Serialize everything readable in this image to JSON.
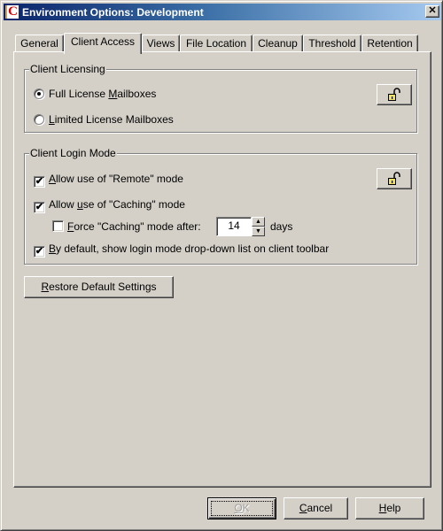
{
  "window": {
    "title": "Environment Options:  Development",
    "app_icon": "c-logo-icon",
    "close_glyph": "✕"
  },
  "tabs": [
    {
      "label": "General",
      "active": false
    },
    {
      "label": "Client Access",
      "active": true
    },
    {
      "label": "Views",
      "active": false
    },
    {
      "label": "File Location",
      "active": false
    },
    {
      "label": "Cleanup",
      "active": false
    },
    {
      "label": "Threshold",
      "active": false
    },
    {
      "label": "Retention",
      "active": false
    }
  ],
  "client_licensing": {
    "label": "Client Licensing",
    "options": [
      {
        "label_pre": "Full License ",
        "mnemonic": "M",
        "label_post": "ailboxes",
        "selected": true
      },
      {
        "label_pre": "",
        "mnemonic": "L",
        "label_post": "imited License Mailboxes",
        "selected": false
      }
    ],
    "lock_icon": "unlocked-padlock-icon"
  },
  "client_login_mode": {
    "label": "Client Login Mode",
    "allow_remote": {
      "label_pre": "",
      "mnemonic": "A",
      "label_post": "llow use of \"Remote\" mode",
      "checked": true
    },
    "allow_caching": {
      "label_pre": "Allow ",
      "mnemonic": "u",
      "label_post": "se of \"Caching\" mode",
      "checked": true
    },
    "force_caching": {
      "label_pre": "",
      "mnemonic": "F",
      "label_post": "orce  \"Caching\" mode after:",
      "checked": false,
      "value": "14",
      "unit": "days"
    },
    "show_dropdown": {
      "label_pre": "",
      "mnemonic": "B",
      "label_post": "y default, show login mode drop-down list on client toolbar",
      "checked": true
    },
    "lock_icon": "unlocked-padlock-icon"
  },
  "restore_button": {
    "label_pre": "",
    "mnemonic": "R",
    "label_post": "estore Default Settings"
  },
  "footer": {
    "ok": {
      "label_pre": "",
      "mnemonic": "O",
      "label_post": "K",
      "enabled": false
    },
    "cancel": {
      "label_pre": "",
      "mnemonic": "C",
      "label_post": "ancel"
    },
    "help": {
      "label_pre": "",
      "mnemonic": "H",
      "label_post": "elp"
    }
  },
  "check_glyph": "✔",
  "spin_up_glyph": "▲",
  "spin_down_glyph": "▼"
}
